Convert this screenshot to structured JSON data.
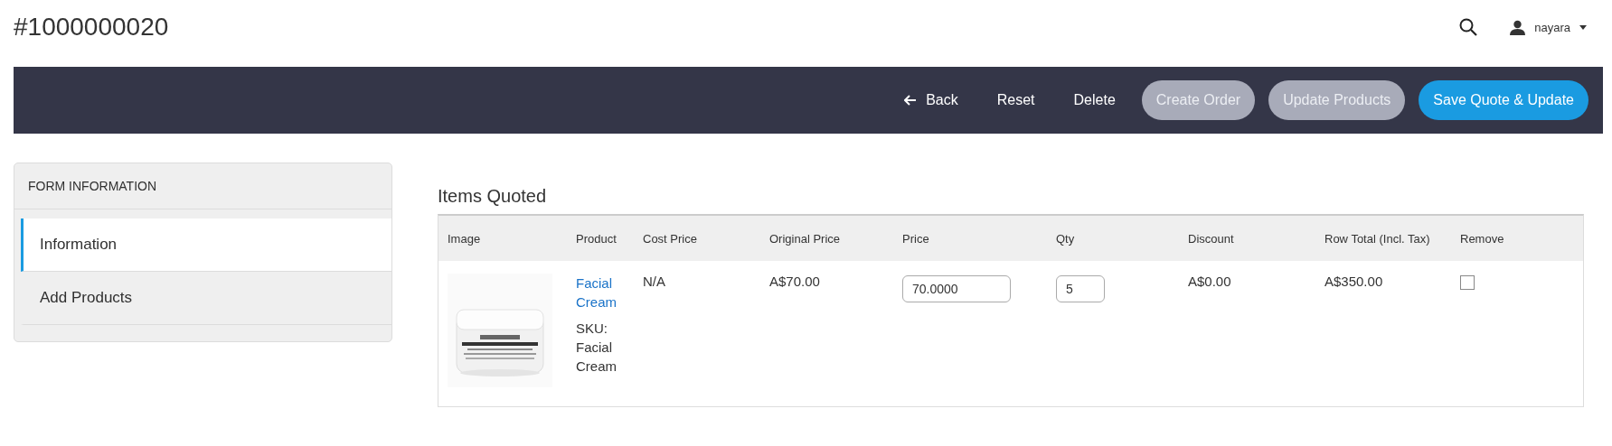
{
  "header": {
    "title": "#1000000020",
    "user": "nayara"
  },
  "toolbar": {
    "buttons": [
      {
        "label": "Back",
        "kind": "back",
        "disabled": false
      },
      {
        "label": "Reset",
        "kind": "link",
        "disabled": false
      },
      {
        "label": "Delete",
        "kind": "link",
        "disabled": false
      },
      {
        "label": "Create Order",
        "kind": "pill",
        "disabled": true
      },
      {
        "label": "Update Products",
        "kind": "pill",
        "disabled": true
      },
      {
        "label": "Save Quote & Update",
        "kind": "pill",
        "disabled": false
      }
    ]
  },
  "sidebar": {
    "heading": "FORM INFORMATION",
    "items": [
      {
        "label": "Information",
        "selected": true
      },
      {
        "label": "Add Products",
        "selected": false
      }
    ]
  },
  "items_quoted": {
    "heading": "Items Quoted",
    "columns": [
      "Image",
      "Product",
      "Cost Price",
      "Original Price",
      "Price",
      "Qty",
      "Discount",
      "Row Total (Incl. Tax)",
      "Remove"
    ],
    "rows": [
      {
        "product": "Facial Cream",
        "sku": "SKU: Facial Cream",
        "cost_price": "N/A",
        "original_price": "A$70.00",
        "price": "70.0000",
        "qty": "5",
        "discount": "A$0.00",
        "row_total": "A$350.00",
        "remove": false
      }
    ]
  }
}
